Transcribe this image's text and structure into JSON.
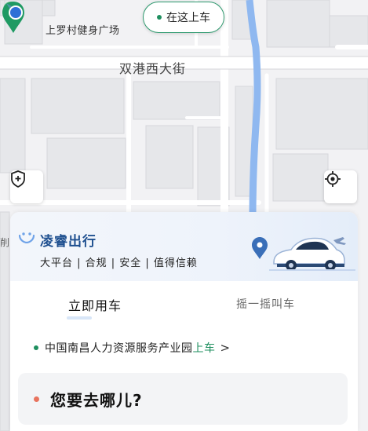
{
  "map": {
    "poi_label": "上罗村健身广场",
    "board_here": "在这上车",
    "road_label": "双港西大街",
    "edge_glyph": "削"
  },
  "brand": {
    "name": "凌睿出行",
    "tags": "大平台 | 合规 | 安全 | 值得信赖"
  },
  "tabs": [
    {
      "label": "立即用车",
      "active": true
    },
    {
      "label": "摇一摇叫车",
      "active": false
    }
  ],
  "pickup": {
    "place": "中国南昌人力资源服务产业园",
    "action": "上车",
    "chevron": ">"
  },
  "destination": {
    "prompt": "您要去哪儿?"
  },
  "colors": {
    "accent_green": "#1f8f5f",
    "brand_blue": "#1e4f8f",
    "river_blue": "#8fb8f0",
    "dest_dot": "#e8735e"
  },
  "icons": [
    "park-poi-icon",
    "map-pin-icon",
    "location-dot-icon",
    "shield-plus-icon",
    "locate-target-icon",
    "brand-logo-icon",
    "car-illustration"
  ]
}
